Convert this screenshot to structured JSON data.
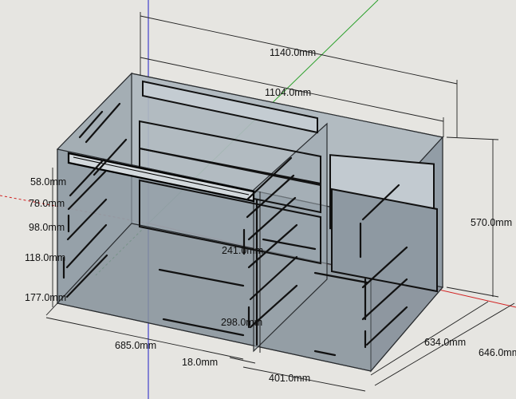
{
  "app": {
    "name": "SketchUp 3D model viewport"
  },
  "colors": {
    "background": "#e6e5e1",
    "cabinet_face": "#8f9aa3",
    "cabinet_back": "#a9b3ba",
    "cabinet_top": "#b6bec4",
    "axis_red": "#d22020",
    "axis_green": "#2aa02a",
    "axis_blue": "#2020c8"
  },
  "icons": {
    "edges": "slot-edge-lines",
    "axes": "red-green-blue-axes"
  },
  "dimensions": {
    "overall_width": "1140.0mm",
    "inner_width": "1104.0mm",
    "height": "570.0mm",
    "depth_inner": "634.0mm",
    "depth_outer": "646.0mm",
    "left_section": "685.0mm",
    "divider": "18.0mm",
    "right_section": "401.0mm",
    "drawer_1": "58.0mm",
    "drawer_2": "78.0mm",
    "drawer_3": "98.0mm",
    "drawer_4": "118.0mm",
    "drawer_5": "177.0mm",
    "mid_upper": "241.0mm",
    "mid_lower": "298.0mm"
  }
}
